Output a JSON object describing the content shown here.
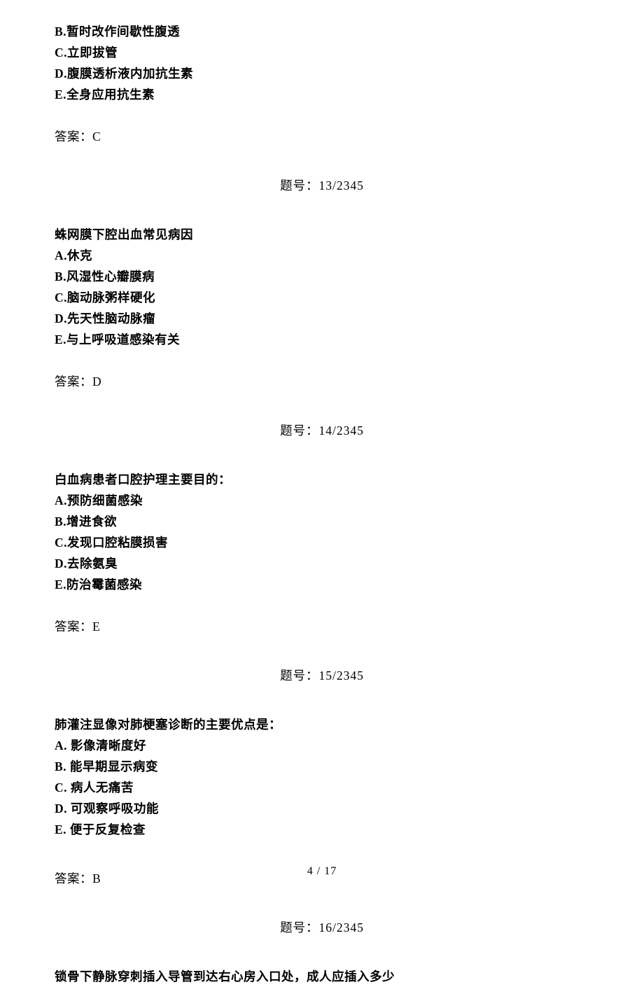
{
  "topOptions": {
    "b": "B.暂时改作间歇性腹透",
    "c": "C.立即拔管",
    "d": "D.腹膜透析液内加抗生素",
    "e": "E.全身应用抗生素"
  },
  "topAnswer": "答案：C",
  "q13": {
    "tihao": "题号：13/2345",
    "stem": "蛛网膜下腔出血常见病因",
    "a": "A.休克",
    "b": "B.风湿性心瓣膜病",
    "c": "C.脑动脉粥样硬化",
    "d": "D.先天性脑动脉瘤",
    "e": "E.与上呼吸道感染有关",
    "answer": "答案：D"
  },
  "q14": {
    "tihao": "题号：14/2345",
    "stem": "白血病患者口腔护理主要目的：",
    "a": "A.预防细菌感染",
    "b": "B.增进食欲",
    "c": "C.发现口腔粘膜损害",
    "d": "D.去除氨臭",
    "e": "E.防治霉菌感染",
    "answer": "答案：E"
  },
  "q15": {
    "tihao": "题号：15/2345",
    "stem": "肺灌注显像对肺梗塞诊断的主要优点是：",
    "a": "A. 影像清晰度好",
    "b": "B. 能早期显示病变",
    "c": "C. 病人无痛苦",
    "d": "D. 可观察呼吸功能",
    "e": "E. 便于反复检查",
    "answer": "答案：B"
  },
  "q16": {
    "tihao": "题号：16/2345",
    "stem": "锁骨下静脉穿刺插入导管到达右心房入口处，成人应插入多少"
  },
  "footer": "4 / 17"
}
